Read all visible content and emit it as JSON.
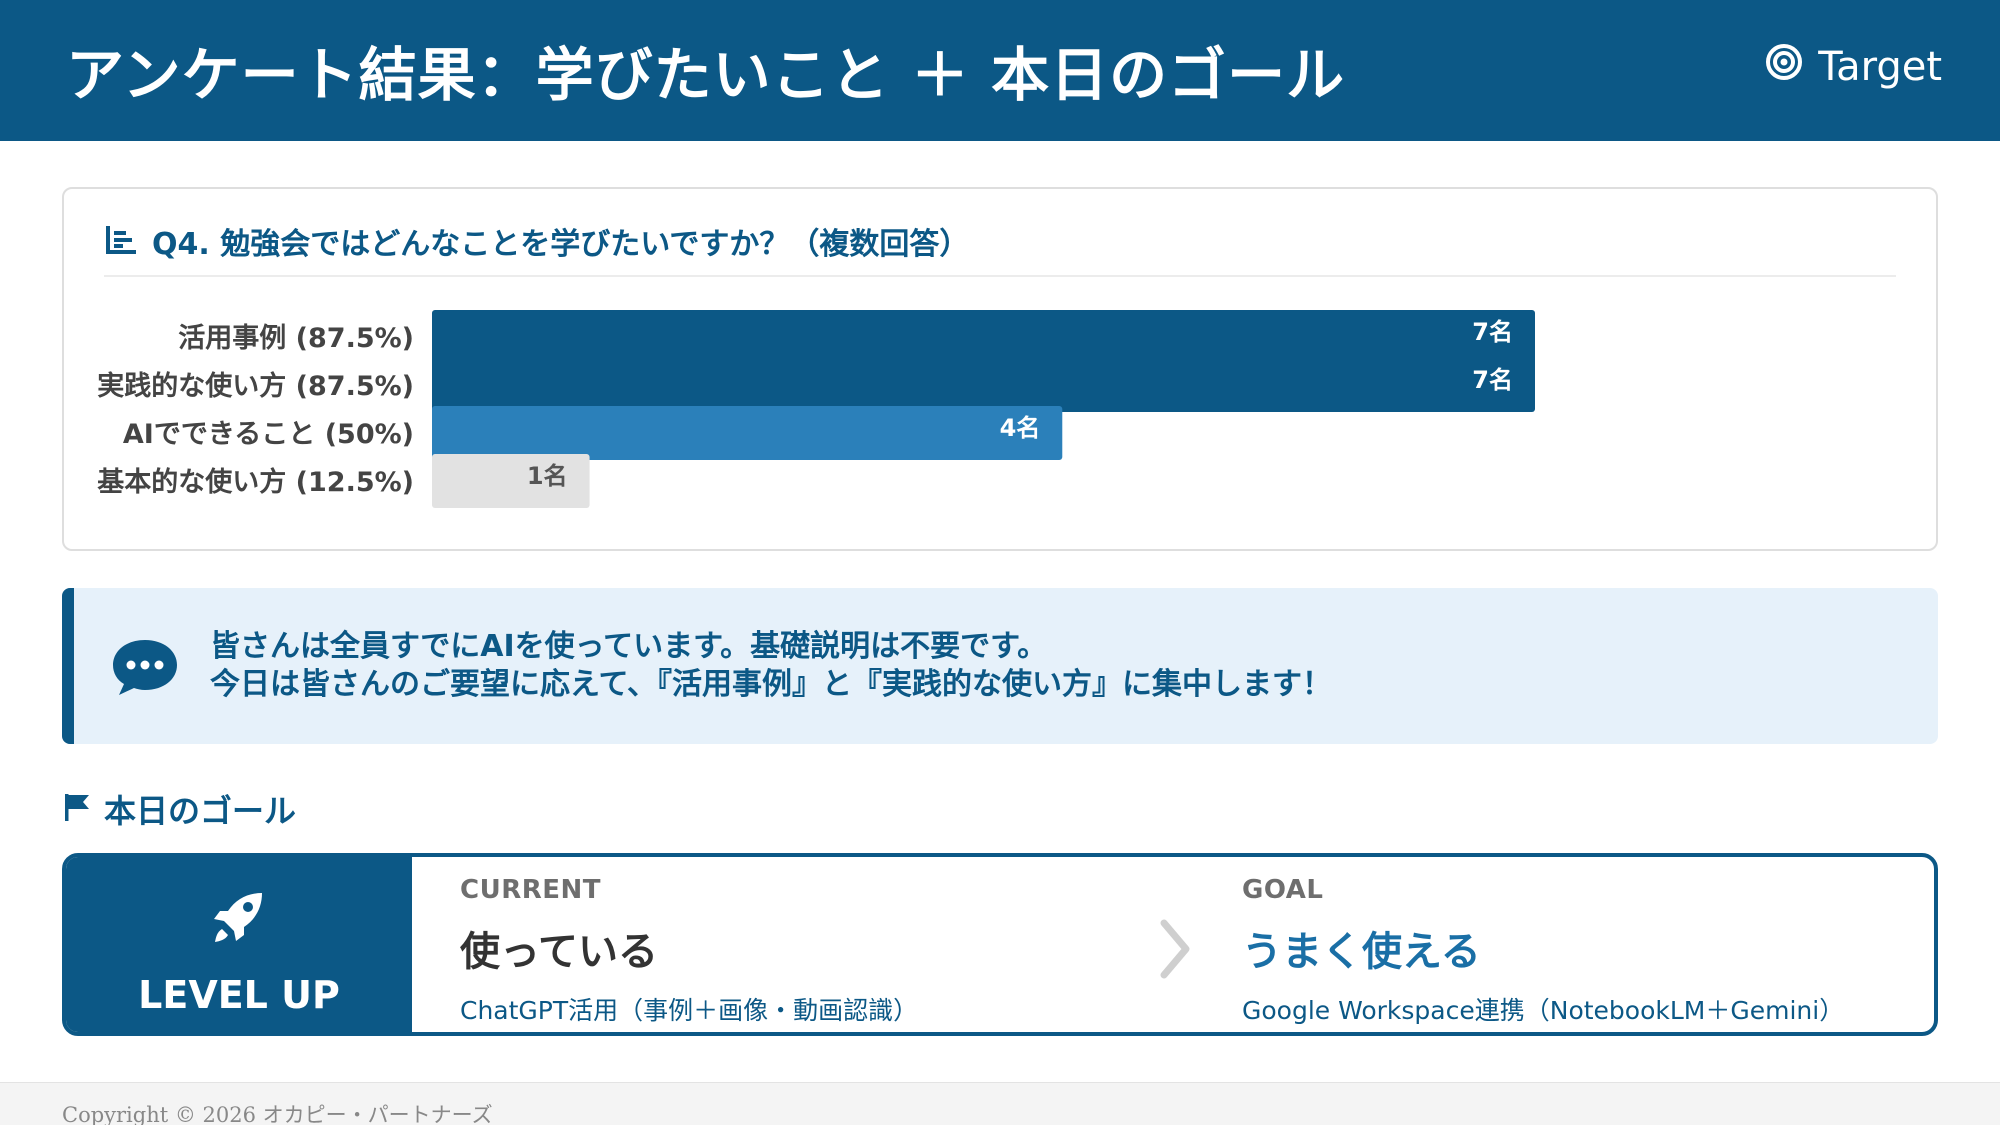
{
  "header": {
    "title": "アンケート結果：学びたいこと ＋ 本日のゴール",
    "tag": "Target",
    "tag_icon": "target-icon"
  },
  "chart": {
    "title": "Q4. 勉強会ではどんなことを学びたいですか？（複数回答）",
    "icon": "bar-chart-icon"
  },
  "chart_data": {
    "type": "bar",
    "orientation": "horizontal",
    "categories": [
      "活用事例 (87.5%)",
      "実践的な使い方 (87.5%)",
      "AIでできること (50%)",
      "基本的な使い方 (12.5%)"
    ],
    "values": [
      7,
      7,
      4,
      1
    ],
    "data_labels": [
      "7名",
      "7名",
      "4名",
      "1名"
    ],
    "colors": [
      "#0c5886",
      "#0c5886",
      "#2b80ba",
      "#e2e2e2"
    ],
    "label_colors": [
      "#ffffff",
      "#ffffff",
      "#ffffff",
      "#555555"
    ],
    "xlim": [
      0,
      8
    ],
    "grid": false,
    "legend": "none"
  },
  "note": {
    "icon": "chat-bubble-icon",
    "line1": "皆さんは全員すでにAIを使っています。基礎説明は不要です。",
    "line2": "今日は皆さんのご要望に応えて、『活用事例』と『実践的な使い方』に集中します！"
  },
  "goal": {
    "heading": "本日のゴール",
    "heading_icon": "flag-icon",
    "level_label": "LEVEL UP",
    "level_icon": "rocket-icon",
    "current": {
      "label": "CURRENT",
      "main": "使っている",
      "sub": "ChatGPT活用（事例＋画像・動画認識）"
    },
    "arrow_icon": "chevron-right-icon",
    "target": {
      "label": "GOAL",
      "main": "うまく使える",
      "sub": "Google Workspace連携（NotebookLM＋Gemini）"
    }
  },
  "footer": {
    "copyright": "Copyright © 2026 オカピー・パートナーズ"
  },
  "colors": {
    "primary": "#0c5886",
    "secondary": "#2b80ba",
    "muted_bar": "#e2e2e2",
    "note_bg": "#e6f1fa"
  }
}
